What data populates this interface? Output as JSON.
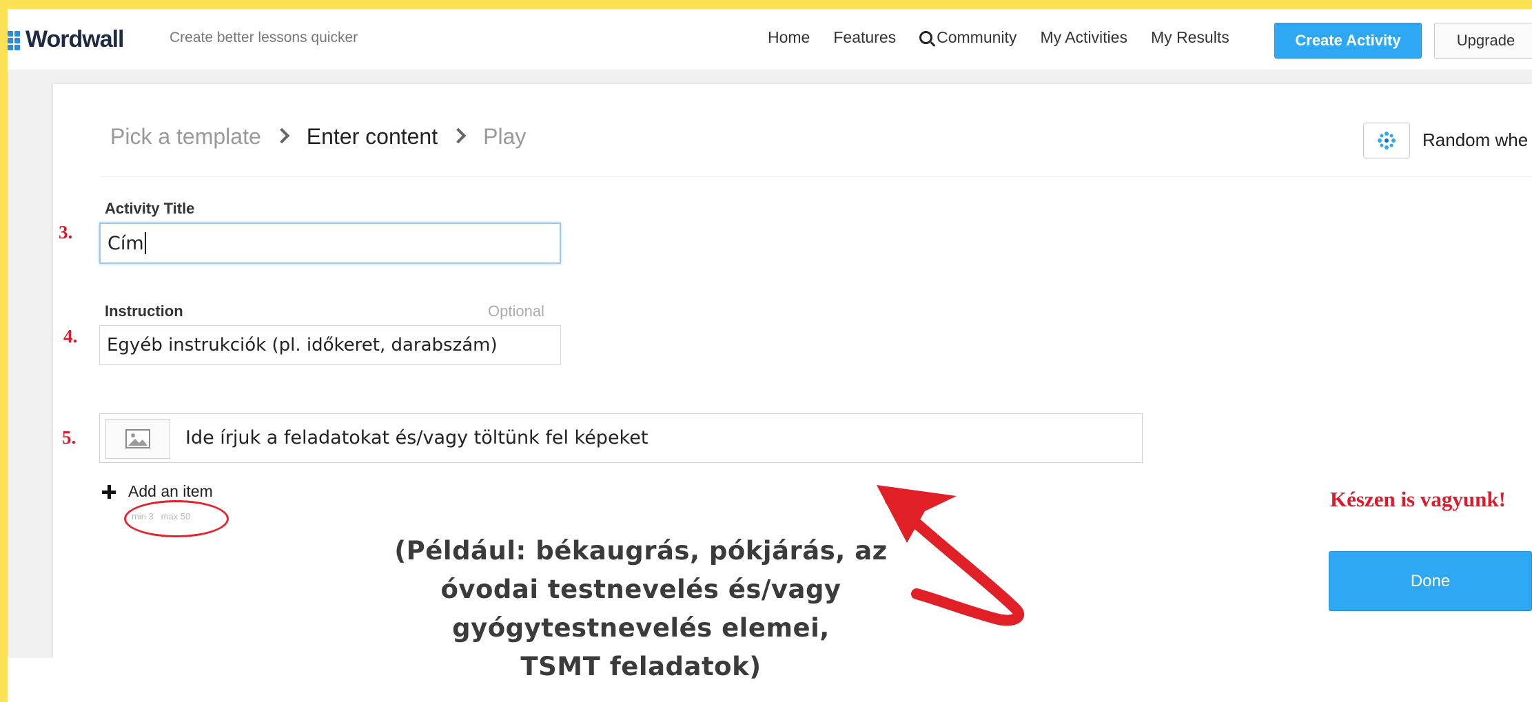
{
  "navbar": {
    "logo_text": "Wordwall",
    "tagline": "Create better lessons quicker",
    "links": [
      "Home",
      "Features",
      "Community",
      "My Activities",
      "My Results"
    ],
    "create_label": "Create Activity",
    "upgrade_label": "Upgrade"
  },
  "breadcrumb": {
    "step1": "Pick a template",
    "step2": "Enter content",
    "step3": "Play"
  },
  "template": {
    "name": "Random whe",
    "icon": "random-wheel-icon"
  },
  "form": {
    "title_label": "Activity Title",
    "title_value": "Cím",
    "instruction_label": "Instruction",
    "instruction_optional": "Optional",
    "instruction_value": "Egyéb instrukciók (pl. időkeret, darabszám)",
    "item_value": "Ide írjuk a feladatokat és/vagy töltünk fel képeket",
    "add_item_label": "Add an item",
    "min_label": "min 3",
    "max_label": "max 50"
  },
  "steps": {
    "s3": "3.",
    "s4": "4.",
    "s5": "5."
  },
  "annotation": {
    "line1": "(Például: békaugrás, pókjárás, az",
    "line2": "óvodai testnevelés és/vagy",
    "line3": "gyógytestnevelés elemei,",
    "line4": "TSMT feladatok)"
  },
  "done": {
    "ready_text": "Készen is vagyunk!",
    "button_label": "Done"
  },
  "colors": {
    "frame": "#fde154",
    "accent": "#2ea8f3",
    "annotation_red": "#e0192b"
  }
}
